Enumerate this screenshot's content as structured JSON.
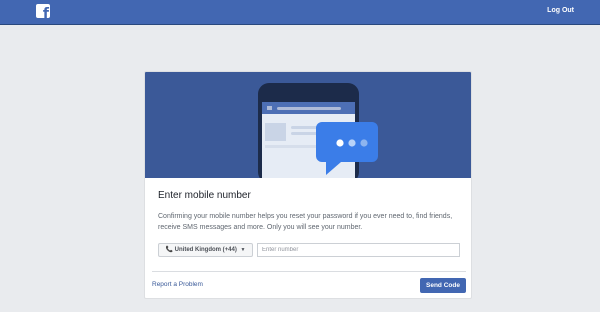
{
  "header": {
    "logo_glyph": "f",
    "logout_label": "Log Out"
  },
  "banner": {
    "icon": "phone-with-chat-bubble-illustration"
  },
  "dialog": {
    "title": "Enter mobile number",
    "description": "Confirming your mobile number helps you reset your password if you ever need to, find friends, receive SMS messages and more. Only you will see your number.",
    "country_selector": {
      "icon": "phone-icon",
      "label": "United Kingdom (+44)"
    },
    "phone_input": {
      "value": "",
      "placeholder": "Enter number"
    },
    "report_link": "Report a Problem",
    "send_button": "Send Code"
  },
  "colors": {
    "brand": "#4267b2",
    "banner": "#3b5998",
    "page_bg": "#e9ebee"
  }
}
